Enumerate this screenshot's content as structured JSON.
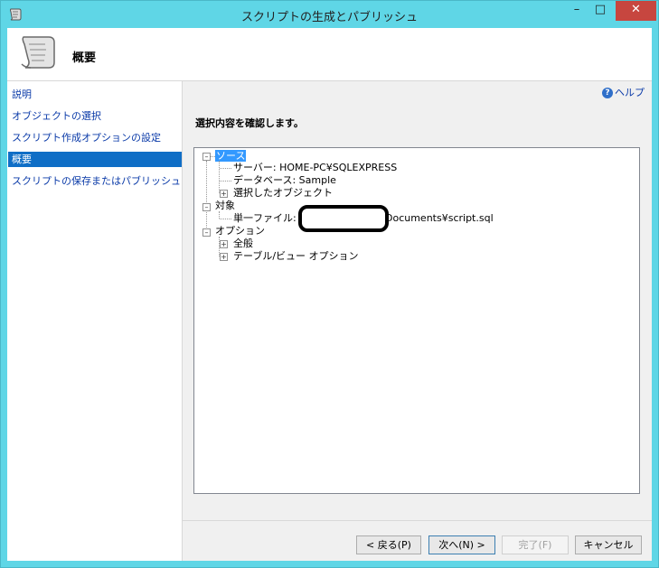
{
  "window": {
    "title": "スクリプトの生成とパブリッシュ",
    "min_glyph": "–",
    "max_glyph": "□",
    "close_glyph": "✕"
  },
  "header": {
    "title": "概要"
  },
  "nav": {
    "items": [
      {
        "label": "説明",
        "selected": false
      },
      {
        "label": "オブジェクトの選択",
        "selected": false
      },
      {
        "label": "スクリプト作成オプションの設定",
        "selected": false
      },
      {
        "label": "概要",
        "selected": true
      },
      {
        "label": "スクリプトの保存またはパブリッシュ",
        "selected": false
      }
    ]
  },
  "help": {
    "label": "ヘルプ",
    "icon": "help-icon",
    "icon_glyph": "?"
  },
  "content": {
    "instruction": "選択内容を確認します。"
  },
  "tree": {
    "source": {
      "label": "ソース",
      "server": "サーバー: HOME-PC¥SQLEXPRESS",
      "database": "データベース: Sample",
      "objects": "選択したオブジェクト"
    },
    "target": {
      "label": "対象",
      "file_prefix": "単一ファイル: C:",
      "file_suffix": "Documents¥script.sql"
    },
    "options": {
      "label": "オプション",
      "general": "全般",
      "table_view": "テーブル/ビュー オプション"
    }
  },
  "buttons": {
    "back": "< 戻る(P)",
    "next": "次へ(N) >",
    "finish": "完了(F)",
    "cancel": "キャンセル"
  },
  "colors": {
    "titlebar": "#5fd6e6",
    "selection": "#0f6ec6",
    "close": "#c7463f",
    "link": "#0a3aa8"
  }
}
